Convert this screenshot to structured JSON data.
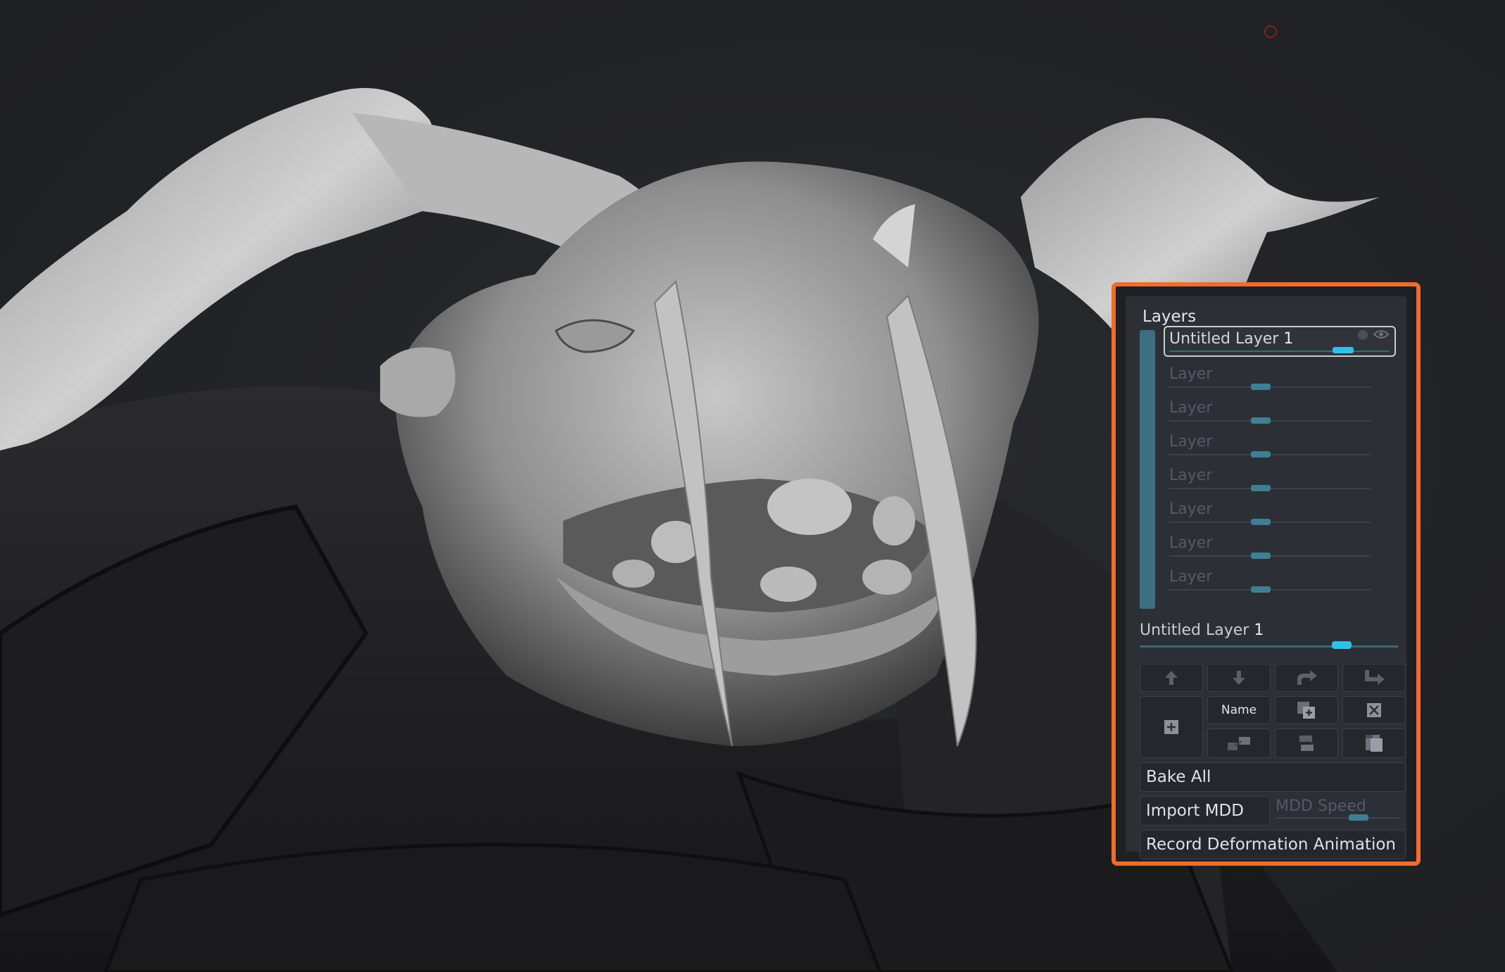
{
  "panel": {
    "title": "Layers",
    "layers": [
      {
        "label": "Untitled Layer",
        "index": "1",
        "active": true
      },
      {
        "label": "Layer"
      },
      {
        "label": "Layer"
      },
      {
        "label": "Layer"
      },
      {
        "label": "Layer"
      },
      {
        "label": "Layer"
      },
      {
        "label": "Layer"
      },
      {
        "label": "Layer"
      }
    ],
    "current_layer": {
      "name": "Untitled Layer",
      "index": "1"
    },
    "buttons": {
      "move_up": "arrow-up-icon",
      "move_down": "arrow-down-icon",
      "redo": "redo-arrow-icon",
      "split": "split-arrow-icon",
      "new": "plus-square-icon",
      "name": "Name",
      "duplicate": "duplicate-icon",
      "delete": "delete-x-icon",
      "merge_down": "merge-icon",
      "swap": "swap-icon",
      "copy": "copy-icon",
      "bake_all": "Bake All",
      "import_mdd": "Import MDD",
      "mdd_speed": "MDD Speed",
      "record": "Record Deformation Animation"
    }
  },
  "colors": {
    "highlight_border": "#f26b2c",
    "slider_active": "#31c0e8",
    "slider_inactive": "#3f7f93",
    "background": "#222326"
  }
}
